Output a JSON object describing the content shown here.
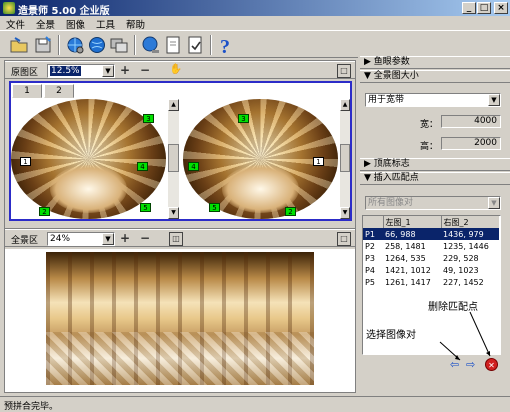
{
  "window": {
    "title": "造景师 5.00 企业版",
    "min": "_",
    "max": "□",
    "close": "×"
  },
  "menu": [
    "文件",
    "全景",
    "图像",
    "工具",
    "帮助"
  ],
  "toolbar_icons": [
    "open-folder-icon",
    "save-icon",
    "globe-gear-icon",
    "globe-icon",
    "photos-icon",
    "globe-export-icon",
    "blank-page-icon",
    "edit-page-icon",
    "help-icon"
  ],
  "source": {
    "label": "原图区",
    "zoom": "12.5%",
    "tabs": [
      "1",
      "2"
    ],
    "left_markers": [
      "3",
      "1",
      "4",
      "2",
      "5"
    ],
    "right_markers": [
      "3",
      "1",
      "4",
      "2",
      "5"
    ]
  },
  "pano": {
    "label": "全景区",
    "zoom": "24%"
  },
  "right": {
    "fisheye_header": "鱼眼参数",
    "size_header": "全景图大小",
    "size_mode": "用于宽带",
    "width_label": "宽：",
    "width_value": "4000",
    "height_label": "高：",
    "height_value": "2000",
    "bottom_header": "顶底标志",
    "insert_header": "插入匹配点",
    "pair_combo": "所有图像对",
    "table": {
      "headers": [
        "",
        "左图_1",
        "右图_2"
      ],
      "rows": [
        [
          "P1",
          "66, 988",
          "1436, 979"
        ],
        [
          "P2",
          "258, 1481",
          "1235, 1446"
        ],
        [
          "P3",
          "1264, 535",
          "229, 528"
        ],
        [
          "P4",
          "1421, 1012",
          "49, 1023"
        ],
        [
          "P5",
          "1261, 1417",
          "227, 1452"
        ]
      ],
      "selected_row": 0
    },
    "annotation_delete": "删除匹配点",
    "annotation_select": "选择图像对",
    "nav_left": "⇦",
    "nav_right": "⇨",
    "delete_btn": "✕"
  },
  "status": "预拼合完毕。",
  "colors": {
    "selection": "#0a246a",
    "marker": "#00e000",
    "frame_blue": "#2c2cc8"
  }
}
